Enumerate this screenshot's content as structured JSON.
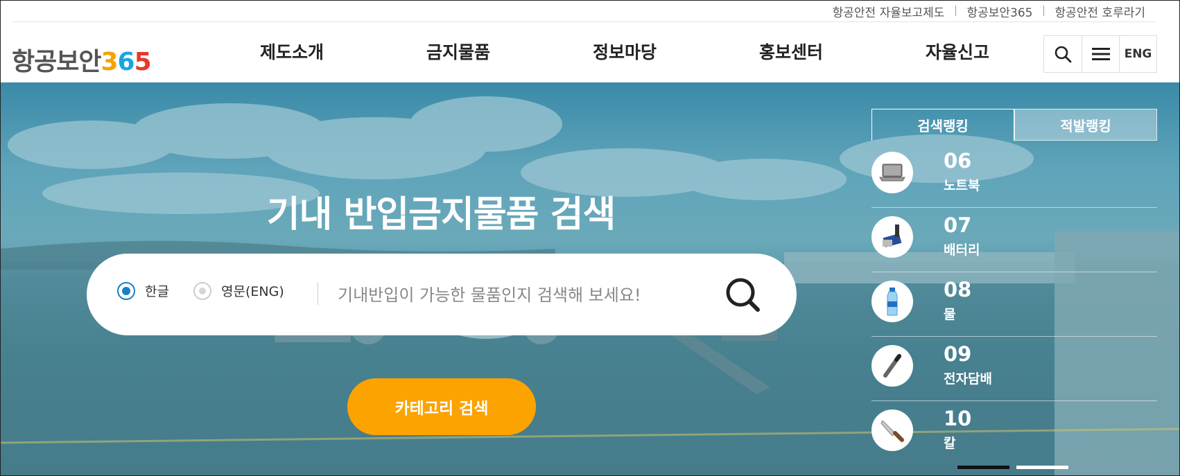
{
  "utility_links": [
    "항공안전 자율보고제도",
    "항공보안365",
    "항공안전 호루라기"
  ],
  "logo": {
    "text": "항공보안",
    "digit1": "3",
    "digit2": "6",
    "digit3": "5"
  },
  "nav": [
    "제도소개",
    "금지물품",
    "정보마당",
    "홍보센터",
    "자율신고"
  ],
  "tools": {
    "search_icon": "search-icon",
    "menu_icon": "menu-icon",
    "eng_label": "ENG"
  },
  "hero": {
    "title": "기내 반입금지물품 검색",
    "radio_korean": "한글",
    "radio_english": "영문(ENG)",
    "radio_selected": "한글",
    "search_placeholder": "기내반입이 가능한 물품인지 검색해 보세요!",
    "category_button": "카테고리 검색"
  },
  "ranking": {
    "tabs": [
      "검색랭킹",
      "적발랭킹"
    ],
    "active_tab": "검색랭킹",
    "items": [
      {
        "rank": "06",
        "name": "노트북",
        "icon": "laptop-icon"
      },
      {
        "rank": "07",
        "name": "배터리",
        "icon": "battery-icon"
      },
      {
        "rank": "08",
        "name": "물",
        "icon": "water-bottle-icon"
      },
      {
        "rank": "09",
        "name": "전자담배",
        "icon": "e-cigarette-icon"
      },
      {
        "rank": "10",
        "name": "칼",
        "icon": "knife-icon"
      }
    ],
    "pager_active_index": 0
  },
  "colors": {
    "accent_orange": "#fca300",
    "radio_blue": "#1b7fc4",
    "logo_3": "#f5a300",
    "logo_6": "#1aa6e0",
    "logo_5": "#e6392b"
  }
}
